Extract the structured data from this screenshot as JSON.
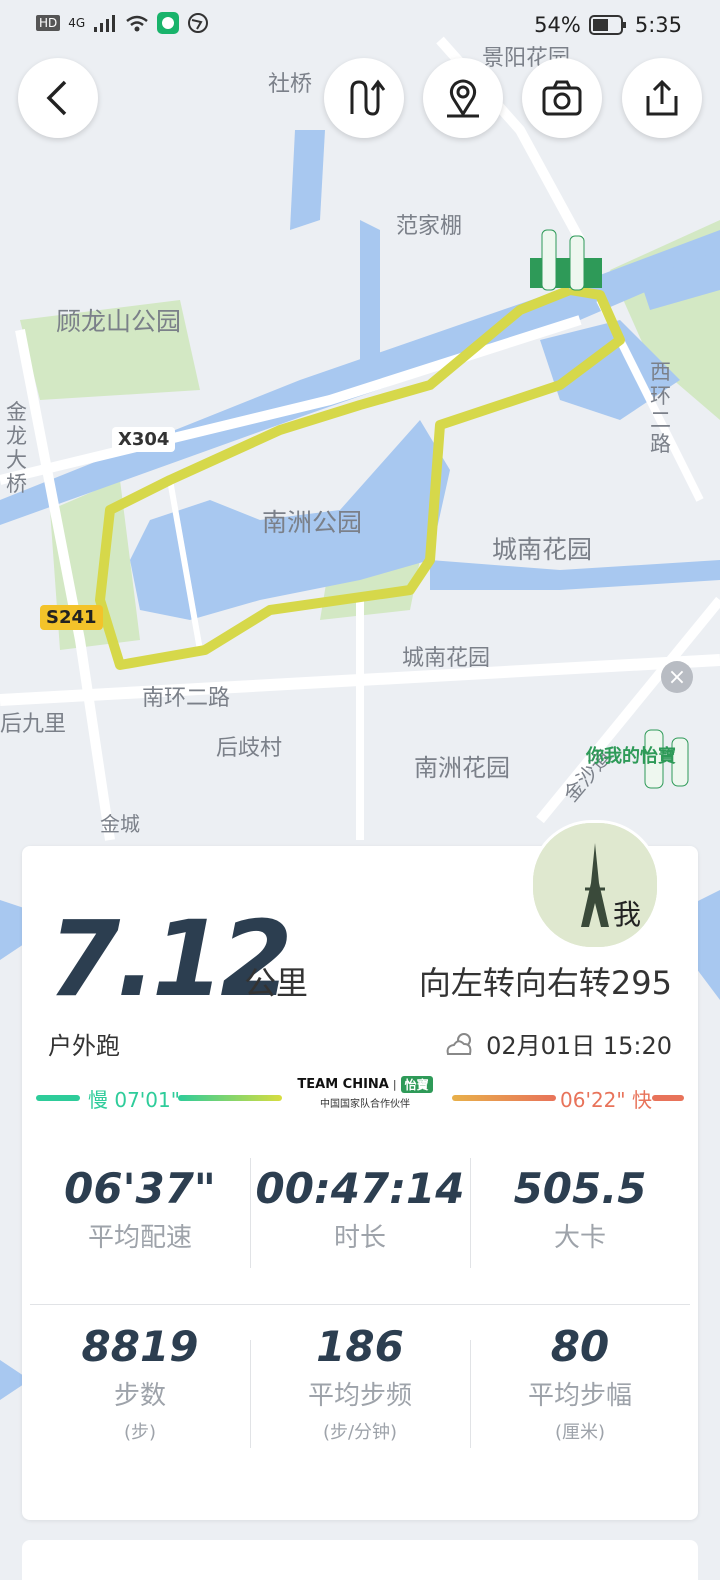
{
  "status_bar": {
    "network": "HD",
    "signal_gen": "4G",
    "battery": "54%",
    "time": "5:35"
  },
  "map": {
    "labels": {
      "jingyang": "景阳花园",
      "sheqiao": "社桥",
      "fanjiapeng": "范家棚",
      "gulongshan": "顾龙山公园",
      "x304": "X304",
      "jinlongdaqiao": "金龙大桥",
      "nanzhou_park": "南洲公园",
      "chengnan_huayuan1": "城南花园",
      "xihuan": "西环二路",
      "s241": "S241",
      "chengnan_huayuan2": "城南花园",
      "nanhuan": "南环二路",
      "houjiuli": "后九里",
      "houqicun": "后歧村",
      "nanzhou_huayuan": "南洲花园",
      "jinsha": "金沙道",
      "jincheng": "金城",
      "ad_text": "你我的怡寶"
    }
  },
  "toolbar": {
    "back_icon": "chevron-left-icon",
    "route_icon": "route-icon",
    "location_icon": "location-pin-icon",
    "camera_icon": "camera-icon",
    "share_icon": "share-icon"
  },
  "summary": {
    "distance": "7.12",
    "distance_unit": "公里",
    "route_name": "向左转向右转295",
    "run_type": "户外跑",
    "date_time": "02月01日 15:20",
    "weather_icon": "partly-cloudy-icon",
    "avatar_text": "我"
  },
  "pace_bar": {
    "slow_label": "慢 07'01\"",
    "fast_label": "06'22\" 快",
    "brand": "TEAM CHINA",
    "brand_sep": "|",
    "brand_partner": "怡寶",
    "brand_sub": "中国国家队合作伙伴",
    "colors": {
      "slow": "#2ecc9a",
      "mid": "#d8dd3f",
      "fast": "#e8735a"
    }
  },
  "stats": {
    "row1": [
      {
        "value": "06'37\"",
        "label": "平均配速"
      },
      {
        "value": "00:47:14",
        "label": "时长"
      },
      {
        "value": "505.5",
        "label": "大卡"
      }
    ],
    "row2": [
      {
        "value": "8819",
        "label": "步数",
        "unit": "(步)"
      },
      {
        "value": "186",
        "label": "平均步频",
        "unit": "(步/分钟)"
      },
      {
        "value": "80",
        "label": "平均步幅",
        "unit": "(厘米)"
      }
    ]
  }
}
